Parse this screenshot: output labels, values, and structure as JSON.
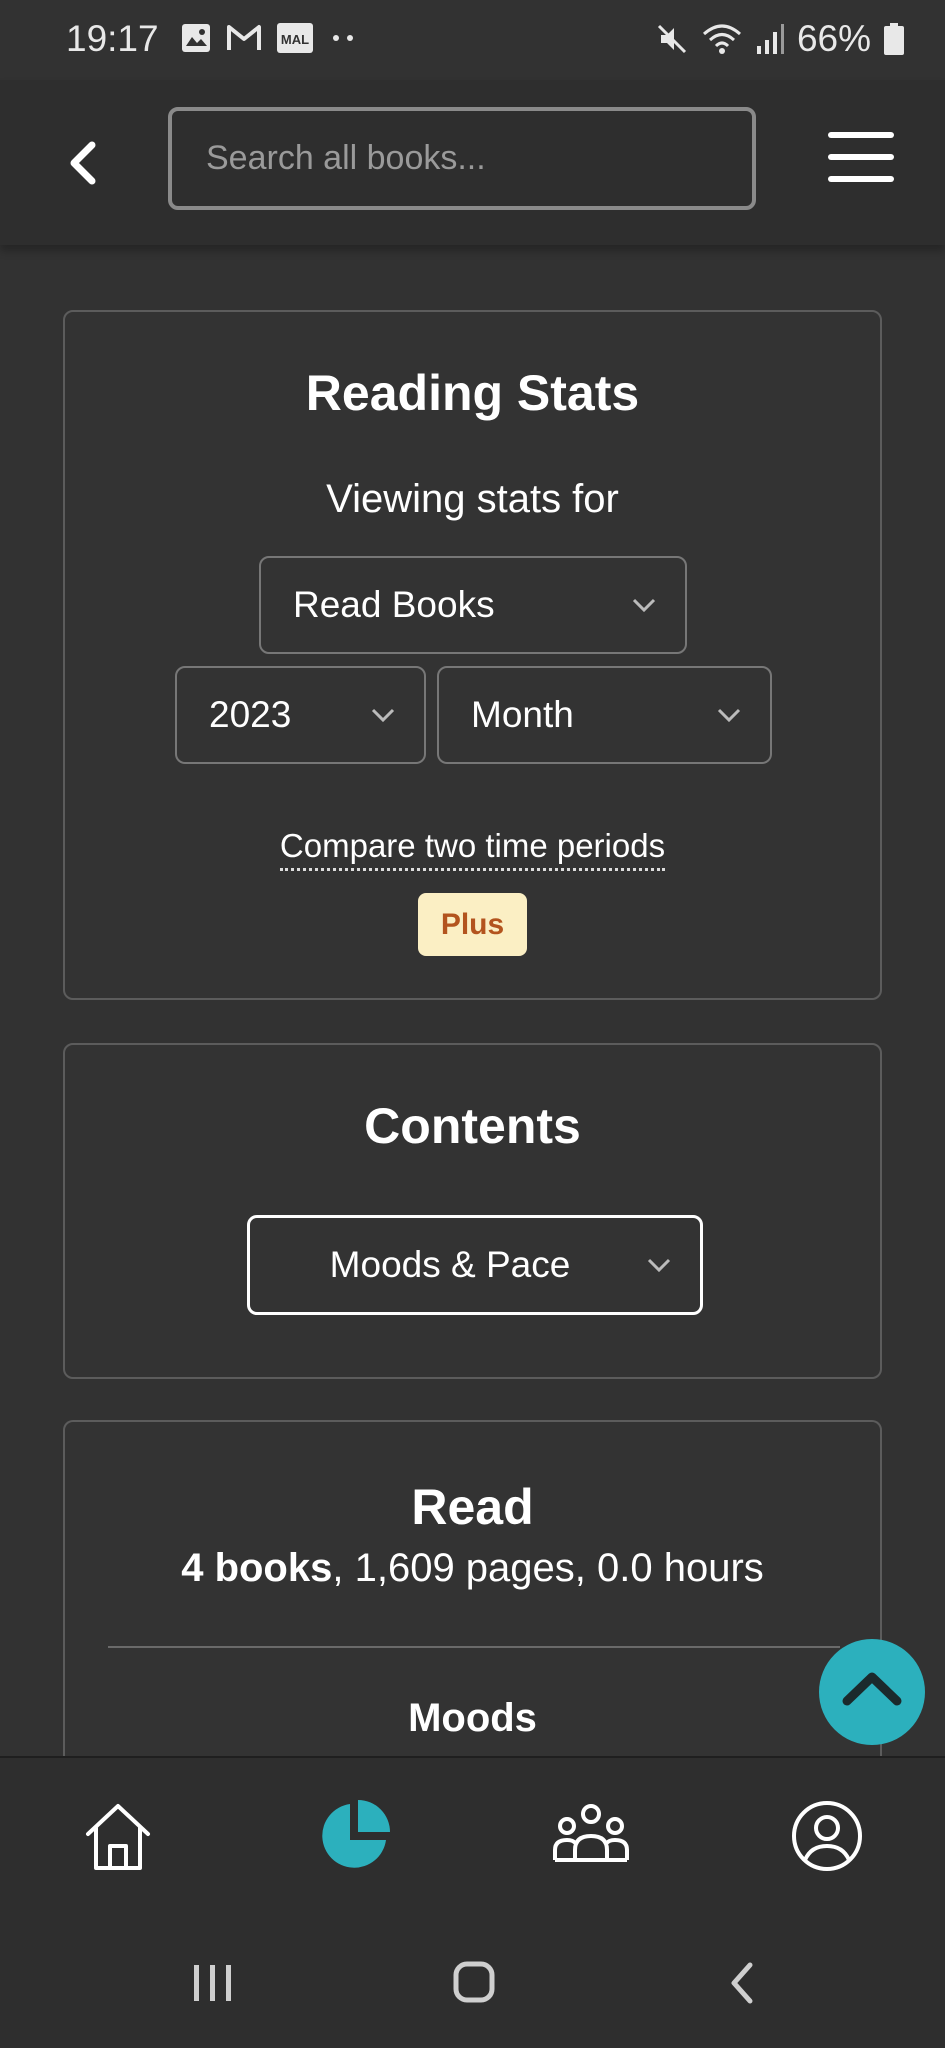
{
  "status_bar": {
    "time": "19:17",
    "battery": "66%",
    "icons_left": [
      "image-icon",
      "gmail-icon",
      "mal-icon",
      "more-dots-icon"
    ],
    "mal_label": "MAL",
    "icons_right": [
      "mute-icon",
      "wifi-icon",
      "signal-icon",
      "battery-icon"
    ]
  },
  "header": {
    "search_placeholder": "Search all books..."
  },
  "stats_card": {
    "title": "Reading Stats",
    "viewing_label": "Viewing stats for",
    "books_filter": "Read Books",
    "year": "2023",
    "period": "Month",
    "compare_link": "Compare two time periods",
    "plus_badge": "Plus"
  },
  "contents_card": {
    "title": "Contents",
    "selected": "Moods & Pace"
  },
  "read_card": {
    "title": "Read",
    "books": "4 books",
    "rest": ", 1,609 pages, 0.0 hours",
    "moods_heading": "Moods"
  },
  "bottom_nav": {
    "items": [
      "home-icon",
      "stats-icon",
      "community-icon",
      "profile-icon"
    ],
    "active": "stats-icon"
  },
  "colors": {
    "background": "#323232",
    "accent": "#2cb0bd",
    "plus_bg": "#fbefc4",
    "plus_text": "#b3541e"
  }
}
